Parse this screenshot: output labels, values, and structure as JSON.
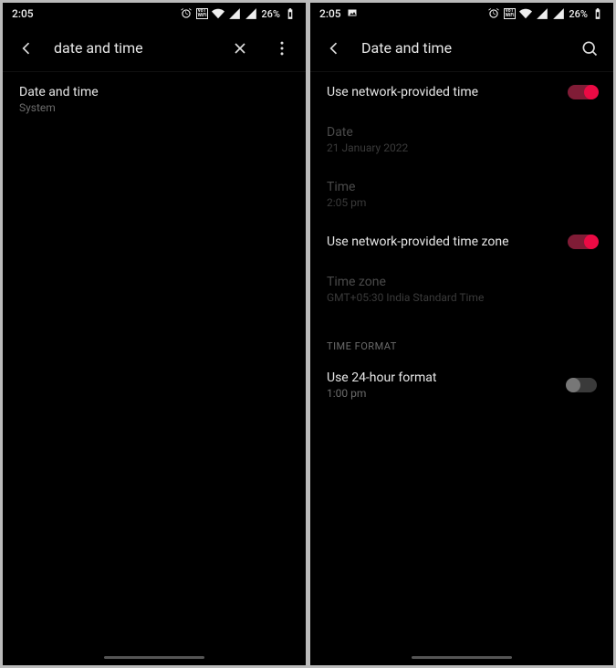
{
  "left": {
    "status": {
      "time": "2:05",
      "battery": "26%"
    },
    "header": {
      "title": "date and time"
    },
    "result": {
      "title": "Date and time",
      "sub": "System"
    }
  },
  "right": {
    "status": {
      "time": "2:05",
      "battery": "26%"
    },
    "header": {
      "title": "Date and time"
    },
    "items": {
      "netTime": {
        "label": "Use network-provided time",
        "on": true
      },
      "date": {
        "label": "Date",
        "value": "21 January 2022"
      },
      "time": {
        "label": "Time",
        "value": "2:05 pm"
      },
      "netZone": {
        "label": "Use network-provided time zone",
        "on": true
      },
      "zone": {
        "label": "Time zone",
        "value": "GMT+05:30 India Standard Time"
      },
      "section": "TIME FORMAT",
      "fmt24": {
        "label": "Use 24-hour format",
        "value": "1:00 pm",
        "on": false
      }
    }
  }
}
